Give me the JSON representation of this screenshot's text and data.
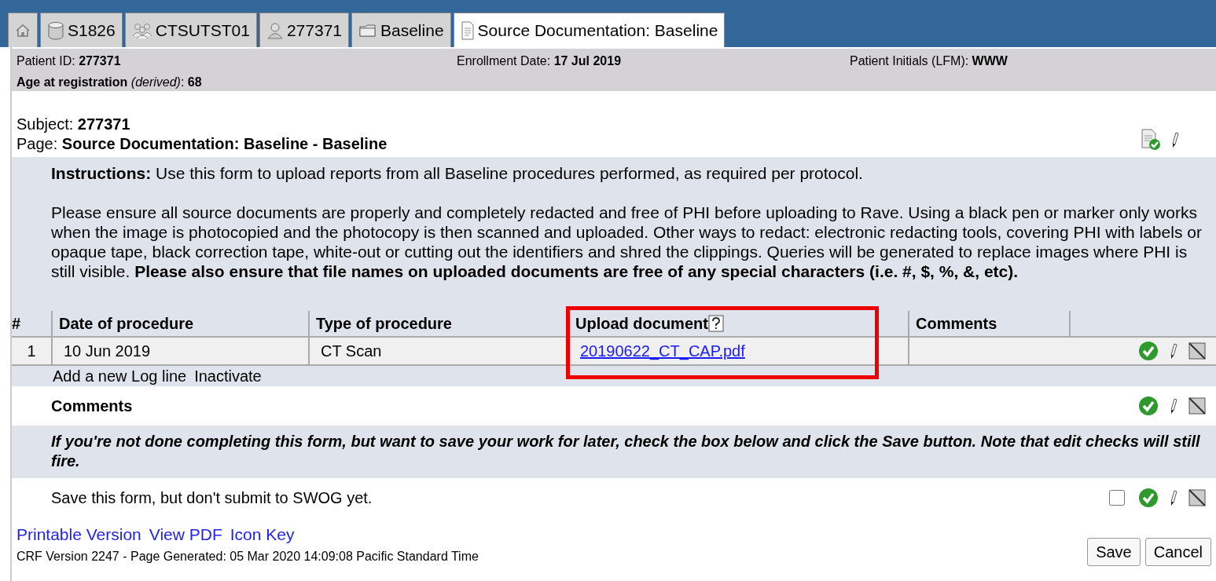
{
  "tabs": [
    {
      "kind": "home",
      "selected": false
    },
    {
      "kind": "study",
      "label": "S1826",
      "selected": false
    },
    {
      "kind": "site",
      "label": "CTSUTST01",
      "selected": false
    },
    {
      "kind": "subject",
      "label": "277371",
      "selected": false
    },
    {
      "kind": "folder",
      "label": "Baseline",
      "selected": false
    },
    {
      "kind": "form",
      "label": "Source Documentation: Baseline",
      "selected": true
    }
  ],
  "header": {
    "patient_id": {
      "label": "Patient ID:",
      "value": "277371"
    },
    "enrollment_date": {
      "label": "Enrollment Date:",
      "value": "17 Jul 2019"
    },
    "patient_initials": {
      "label": "Patient Initials (LFM):",
      "value": "WWW"
    },
    "age": {
      "label": "Age at registration",
      "note": "(derived)",
      "suffix": ":",
      "value": "68"
    }
  },
  "subject": {
    "label": "Subject:",
    "value": "277371"
  },
  "page": {
    "label": "Page:",
    "value": "Source Documentation: Baseline - Baseline"
  },
  "instructions": {
    "label": "Instructions:",
    "text": "Use this form to upload reports from all Baseline procedures performed, as required per protocol.",
    "paragraph": "Please ensure all source documents are properly and completely redacted and free of PHI before uploading to Rave. Using a black pen or marker only works when the image is photocopied and the photocopy is then scanned and uploaded. Other ways to redact: electronic redacting tools, covering PHI with labels or opaque tape, black correction tape, white-out or cutting out the identifiers and shred the clippings. Queries will be generated to replace images where PHI is still visible. **Please also ensure that file names on uploaded documents are free of any special characters (i.e. #, $, %, &, etc).**"
  },
  "table": {
    "columns": [
      "#",
      "Date of procedure",
      "Type of procedure",
      "Upload document",
      "Comments"
    ],
    "rows": [
      {
        "number": "1",
        "date": "10 Jun 2019",
        "type": "CT Scan",
        "document": "20190622_CT_CAP.pdf",
        "comments": ""
      }
    ],
    "actions": [
      "Add a new Log line",
      "Inactivate"
    ]
  },
  "comments": {
    "label": "Comments"
  },
  "note": "If you're not done completing this form, but want to save your work for later, check the box below and click the Save button. Note that edit checks will still fire.",
  "save_for_later": {
    "label": "Save this form, but don't submit to SWOG yet.",
    "checked": false
  },
  "footer": {
    "links": [
      "Printable Version",
      "View PDF",
      "Icon Key"
    ],
    "version": "CRF Version 2247 - Page Generated: 05 Mar 2020 14:09:08 Pacific Standard Time"
  },
  "buttons": [
    "Save",
    "Cancel"
  ]
}
